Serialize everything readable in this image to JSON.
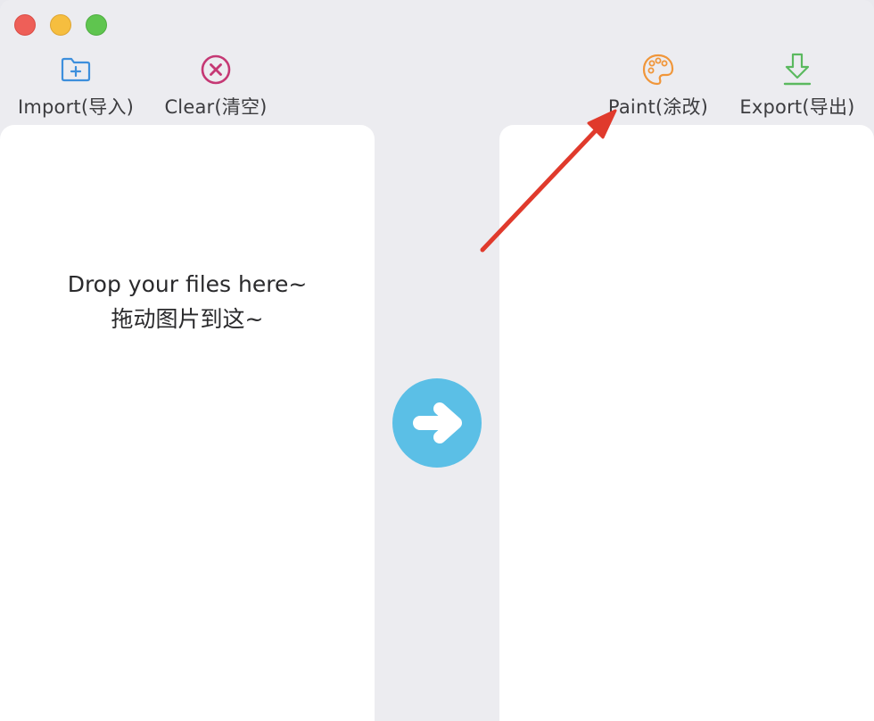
{
  "window": {
    "controls": [
      "close",
      "minimize",
      "zoom"
    ]
  },
  "toolbar": {
    "import": {
      "label": "Import(导入)",
      "icon": "folder-plus-icon",
      "color": "#3d8fdc"
    },
    "clear": {
      "label": "Clear(清空)",
      "icon": "close-circle-icon",
      "color": "#c53874"
    },
    "paint": {
      "label": "Paint(涂改)",
      "icon": "palette-icon",
      "color": "#f0963a"
    },
    "export": {
      "label": "Export(导出)",
      "icon": "download-icon",
      "color": "#5bb95f"
    }
  },
  "input_panel": {
    "drop_text_en": "Drop your files here~",
    "drop_text_zh": "拖动图片到这~"
  },
  "convert": {
    "icon": "arrow-right-icon",
    "color": "#5bbfe6"
  },
  "annotation": {
    "icon": "red-arrow-icon",
    "color": "#e03a2c"
  }
}
